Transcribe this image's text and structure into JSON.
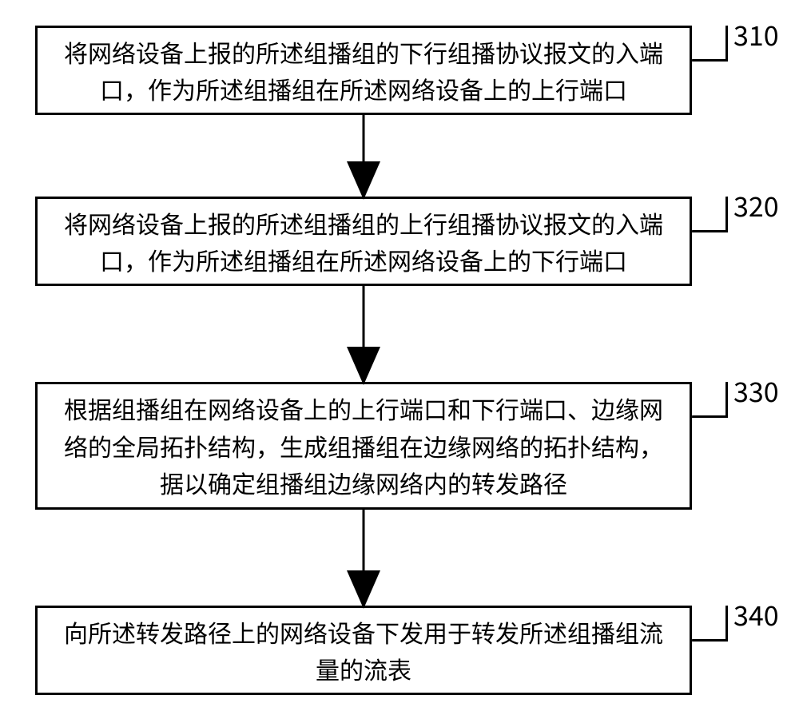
{
  "flow": {
    "nodes": [
      {
        "id": "310",
        "label": "310",
        "text": "将网络设备上报的所述组播组的下行组播协议报文的入端口，作为所述组播组在所述网络设备上的上行端口"
      },
      {
        "id": "320",
        "label": "320",
        "text": "将网络设备上报的所述组播组的上行组播协议报文的入端口，作为所述组播组在所述网络设备上的下行端口"
      },
      {
        "id": "330",
        "label": "330",
        "text": "根据组播组在网络设备上的上行端口和下行端口、边缘网络的全局拓扑结构，生成组播组在边缘网络的拓扑结构，据以确定组播组边缘网络内的转发路径"
      },
      {
        "id": "340",
        "label": "340",
        "text": "向所述转发路径上的网络设备下发用于转发所述组播组流量的流表"
      }
    ],
    "edges": [
      {
        "from": "310",
        "to": "320"
      },
      {
        "from": "320",
        "to": "330"
      },
      {
        "from": "330",
        "to": "340"
      }
    ]
  }
}
